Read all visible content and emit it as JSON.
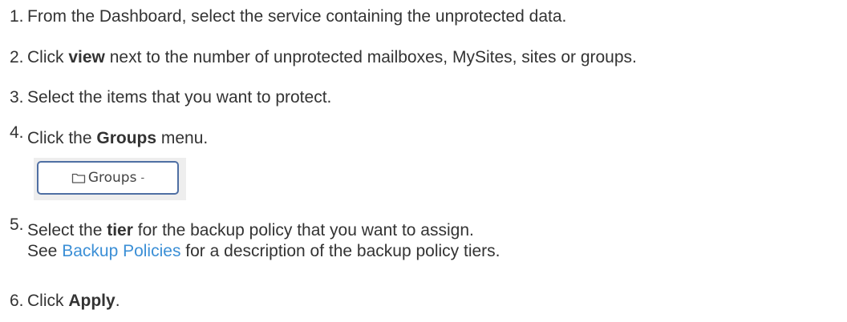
{
  "steps": [
    {
      "number": "1.",
      "text": "From the Dashboard, select the service containing the unprotected data."
    },
    {
      "number": "2.",
      "pre": "Click ",
      "bold": "view",
      "post": " next to the number of unprotected mailboxes, MySites, sites or groups."
    },
    {
      "number": "3.",
      "text": "Select the items that you want to protect."
    },
    {
      "number": "4.",
      "pre": "Click the ",
      "bold": "Groups",
      "post": " menu.",
      "button": {
        "label": "Groups",
        "icon": "folder-icon",
        "caret": "-"
      }
    },
    {
      "number": "5.",
      "pre": "Select the ",
      "bold": "tier",
      "post": " for the backup policy that you want to assign.",
      "line2_pre": "See ",
      "link": "Backup Policies",
      "line2_post": " for a description of the backup policy tiers."
    },
    {
      "number": "6.",
      "pre": "Click ",
      "bold": "Apply",
      "post": "."
    }
  ],
  "colors": {
    "text": "#333333",
    "link": "#3b8fd6",
    "button_border": "#4f6fa3"
  }
}
